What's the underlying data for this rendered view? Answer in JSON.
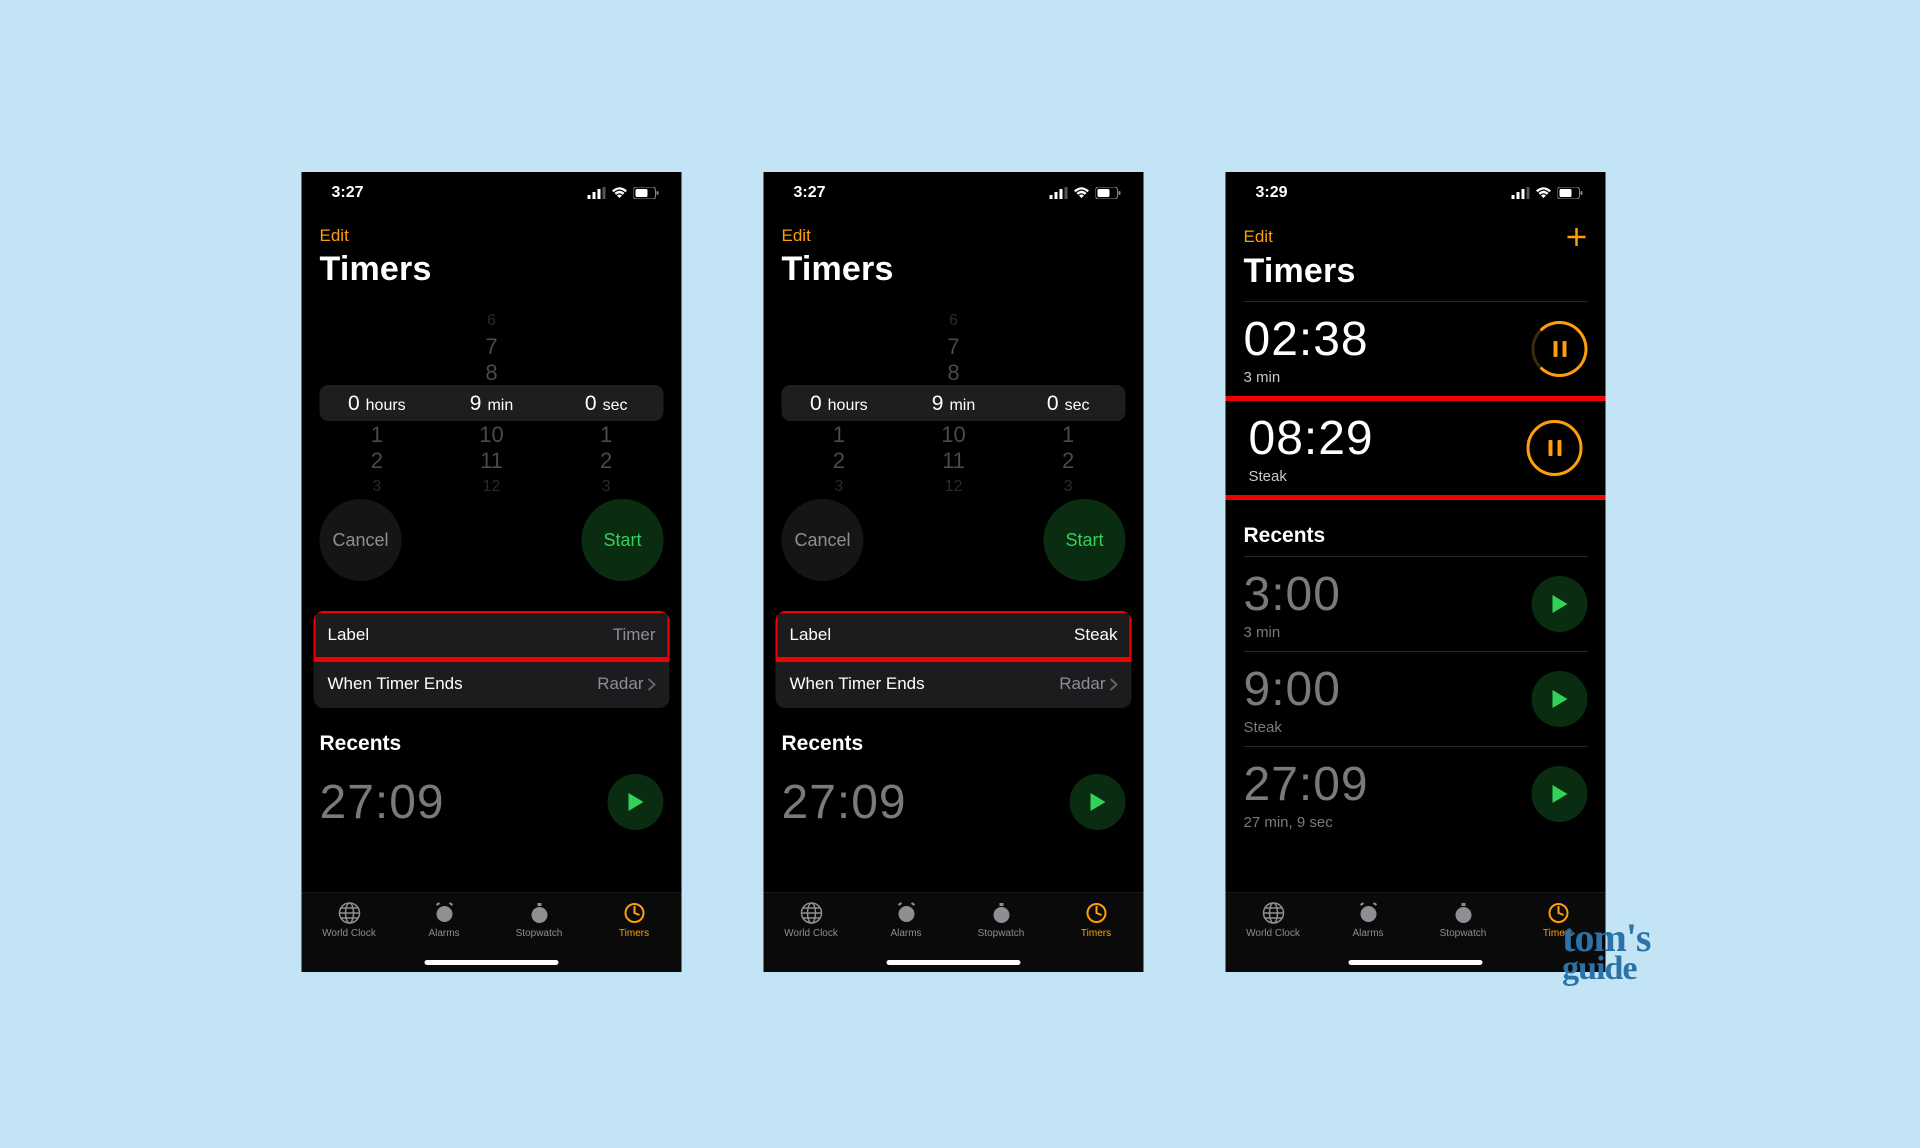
{
  "colors": {
    "accent": "#ff9e0c",
    "green": "#32d158",
    "red_highlight": "#f40000"
  },
  "screens": [
    {
      "status_time": "3:27",
      "edit_label": "Edit",
      "show_plus": false,
      "title": "Timers",
      "picker": {
        "hours": {
          "selected": "0",
          "unit": "hours",
          "adj": [
            "1",
            "2"
          ],
          "pre": []
        },
        "mins": {
          "selected": "9",
          "unit": "min",
          "pre": [
            "6",
            "7",
            "8"
          ],
          "adj": [
            "10",
            "11",
            "12"
          ]
        },
        "secs": {
          "selected": "0",
          "unit": "sec",
          "adj": [
            "1",
            "2",
            "3"
          ],
          "pre": []
        }
      },
      "cancel_label": "Cancel",
      "start_label": "Start",
      "options": {
        "label_key": "Label",
        "label_value": "Timer",
        "ends_key": "When Timer Ends",
        "ends_value": "Radar"
      },
      "recents_header": "Recents",
      "recents": [
        {
          "time": "27:09",
          "sub": ""
        }
      ],
      "tabs": [
        "World Clock",
        "Alarms",
        "Stopwatch",
        "Timers"
      ],
      "active_tab": 3
    },
    {
      "status_time": "3:27",
      "edit_label": "Edit",
      "show_plus": false,
      "title": "Timers",
      "picker": {
        "hours": {
          "selected": "0",
          "unit": "hours",
          "adj": [
            "1",
            "2"
          ],
          "pre": []
        },
        "mins": {
          "selected": "9",
          "unit": "min",
          "pre": [
            "6",
            "7",
            "8"
          ],
          "adj": [
            "10",
            "11",
            "12"
          ]
        },
        "secs": {
          "selected": "0",
          "unit": "sec",
          "adj": [
            "1",
            "2",
            "3"
          ],
          "pre": []
        }
      },
      "cancel_label": "Cancel",
      "start_label": "Start",
      "options": {
        "label_key": "Label",
        "label_value": "Steak",
        "ends_key": "When Timer Ends",
        "ends_value": "Radar"
      },
      "recents_header": "Recents",
      "recents": [
        {
          "time": "27:09",
          "sub": ""
        }
      ],
      "tabs": [
        "World Clock",
        "Alarms",
        "Stopwatch",
        "Timers"
      ],
      "active_tab": 3
    },
    {
      "status_time": "3:29",
      "edit_label": "Edit",
      "show_plus": true,
      "title": "Timers",
      "active_timers": [
        {
          "time": "02:38",
          "sub": "3 min"
        },
        {
          "time": "08:29",
          "sub": "Steak",
          "highlight": true
        }
      ],
      "recents_header": "Recents",
      "recents": [
        {
          "time": "3:00",
          "sub": "3 min"
        },
        {
          "time": "9:00",
          "sub": "Steak"
        },
        {
          "time": "27:09",
          "sub": "27 min, 9 sec"
        }
      ],
      "tabs": [
        "World Clock",
        "Alarms",
        "Stopwatch",
        "Timers"
      ],
      "active_tab": 3
    }
  ],
  "watermark": {
    "line1": "tom's",
    "line2": "guide"
  }
}
